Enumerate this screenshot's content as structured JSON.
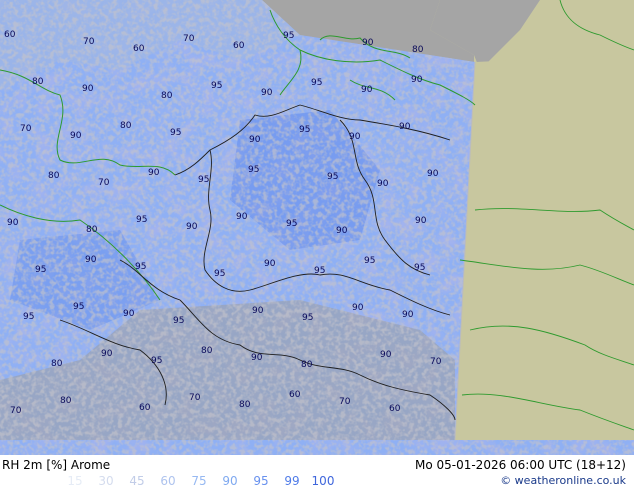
{
  "title": "RH 2m [%] Arome",
  "valid_time": "Mo 05-01-2026 06:00 UTC (18+12)",
  "credit": "© weatheronline.co.uk",
  "legend": {
    "values": [
      "15",
      "30",
      "45",
      "60",
      "75",
      "90",
      "95",
      "99",
      "100"
    ],
    "colors": [
      "#e6ecf6",
      "#d4dcee",
      "#c2cde8",
      "#aec3ee",
      "#97b9f2",
      "#7fa9f0",
      "#6891ee",
      "#4f7be8",
      "#3f66dc"
    ]
  },
  "colors": {
    "land_outside": "#c8c79f",
    "sea_outside": "#a5a5a5",
    "field_base": "#8fb0f4",
    "field_dark": "#5a86ec",
    "lowland_grey": "#9e9e9e",
    "border_line": "#1f1f1f",
    "coast_line": "#2e9a2e"
  },
  "contour_labels": {
    "row1": [
      "60",
      "70",
      "60",
      "70",
      "60",
      "95",
      "90",
      "80"
    ],
    "row2": [
      "80",
      "90",
      "80",
      "95",
      "90",
      "95",
      "90",
      "90"
    ],
    "row3": [
      "70",
      "90",
      "80",
      "95",
      "90",
      "95",
      "90",
      "90"
    ],
    "row4": [
      "80",
      "70",
      "90",
      "95",
      "95",
      "95",
      "90",
      "90"
    ],
    "row5": [
      "90",
      "80",
      "95",
      "90",
      "90",
      "95",
      "90",
      "90"
    ],
    "row6": [
      "95",
      "90",
      "95",
      "95",
      "90",
      "95",
      "95",
      "95"
    ],
    "row7": [
      "95",
      "95",
      "90",
      "95",
      "90",
      "95",
      "90",
      "90"
    ],
    "row8": [
      "80",
      "90",
      "95",
      "80",
      "90",
      "80",
      "90",
      "70"
    ],
    "row9": [
      "70",
      "80",
      "60",
      "70",
      "80",
      "60",
      "70",
      "60"
    ]
  }
}
